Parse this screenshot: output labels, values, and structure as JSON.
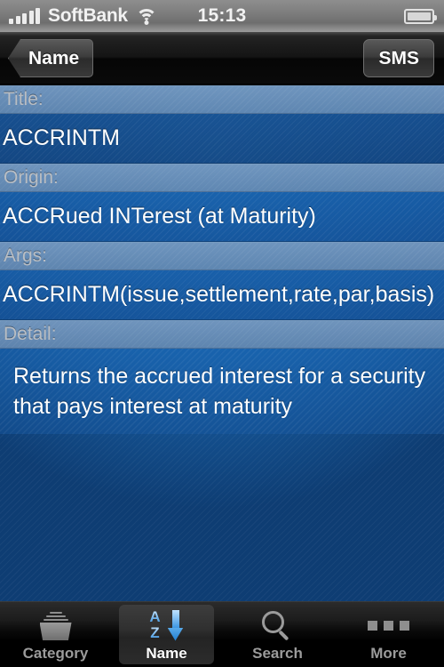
{
  "status_bar": {
    "signal_icon": "signal-bars-icon",
    "carrier": "SoftBank",
    "wifi_icon": "wifi-icon",
    "time": "15:13",
    "battery_icon": "battery-icon"
  },
  "nav_bar": {
    "back_label": "Name",
    "right_label": "SMS"
  },
  "fields": [
    {
      "header": "Title:",
      "value": "ACCRINTM"
    },
    {
      "header": "Origin:",
      "value": "ACCRued INTerest (at Maturity)"
    },
    {
      "header": "Args:",
      "value": "ACCRINTM(issue,settlement,rate,par,basis)"
    },
    {
      "header": "Detail:",
      "value": "Returns the accrued interest for a security that pays interest at maturity"
    }
  ],
  "tab_bar": {
    "tabs": [
      {
        "label": "Category",
        "icon": "tray-icon",
        "selected": false
      },
      {
        "label": "Name",
        "icon": "sort-az-icon",
        "selected": true
      },
      {
        "label": "Search",
        "icon": "search-icon",
        "selected": false
      },
      {
        "label": "More",
        "icon": "ellipsis-icon",
        "selected": false
      }
    ]
  },
  "colors": {
    "accent_blue": "#1e72bd",
    "header_row": "#6e8ab4",
    "value_row": "#164c8b",
    "nav_bar": "#0a0a0a",
    "tab_selected_text": "#ffffff",
    "tab_text": "#9b9b9b"
  }
}
